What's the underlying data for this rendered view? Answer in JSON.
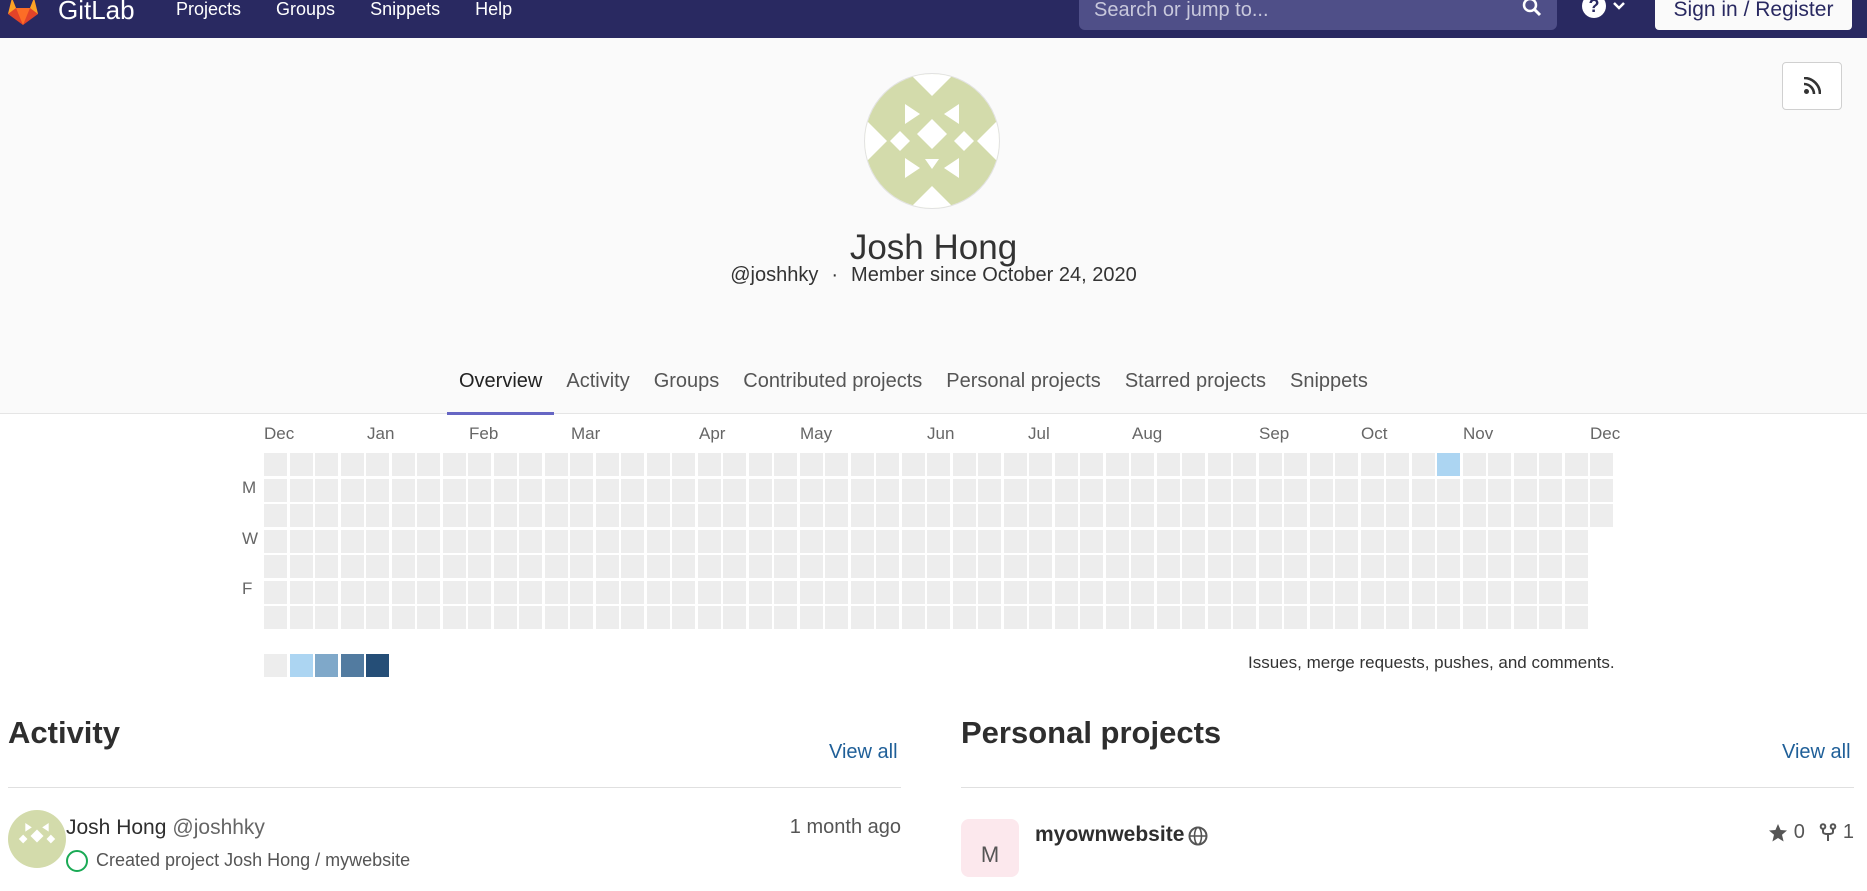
{
  "navbar": {
    "brand": "GitLab",
    "links": [
      "Projects",
      "Groups",
      "Snippets",
      "Help"
    ],
    "search_placeholder": "Search or jump to...",
    "signin_label": "Sign in / Register",
    "help_glyph": "?",
    "colors": {
      "bg": "#292961",
      "search_bg": "#4f4f88"
    }
  },
  "profile": {
    "name": "Josh Hong",
    "username": "@joshhky",
    "separator": "·",
    "member_since": "Member since October 24, 2020",
    "tabs": [
      "Overview",
      "Activity",
      "Groups",
      "Contributed projects",
      "Personal projects",
      "Starred projects",
      "Snippets"
    ],
    "active_tab": "Overview",
    "rss_icon": "rss-icon",
    "avatar_color": "#d3dbab"
  },
  "calendar": {
    "months": [
      "Dec",
      "Jan",
      "Feb",
      "Mar",
      "Apr",
      "May",
      "Jun",
      "Jul",
      "Aug",
      "Sep",
      "Oct",
      "Nov",
      "Dec"
    ],
    "days": [
      "M",
      "W",
      "F"
    ],
    "note": "Issues, merge requests, pushes, and comments.",
    "legend_colors": [
      "#ededed",
      "#acd5f2",
      "#7fa8c9",
      "#527ba0",
      "#254e77"
    ],
    "empty_color": "#ededed",
    "active_color": "#acd5f2"
  },
  "activity": {
    "title": "Activity",
    "view_all": "View all",
    "items": [
      {
        "name": "Josh Hong",
        "username": "@joshhky",
        "time": "1 month ago",
        "detail": "Created project Josh Hong / mywebsite"
      }
    ]
  },
  "projects": {
    "title": "Personal projects",
    "view_all": "View all",
    "items": [
      {
        "initial": "M",
        "name": "myownwebsite",
        "stars": "0",
        "forks": "1"
      }
    ]
  }
}
